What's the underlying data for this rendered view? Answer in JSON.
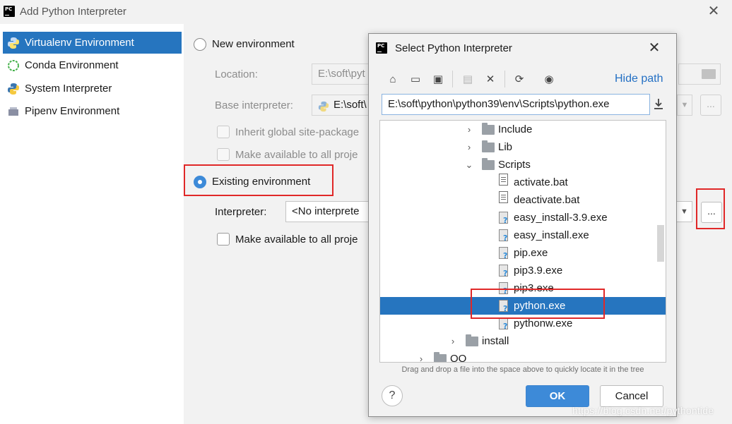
{
  "window": {
    "title": "Add Python Interpreter",
    "close_glyph": "✕"
  },
  "sidebar": {
    "items": [
      {
        "label": "Virtualenv Environment",
        "icon": "virtualenv-icon",
        "selected": true
      },
      {
        "label": "Conda Environment",
        "icon": "conda-icon",
        "selected": false
      },
      {
        "label": "System Interpreter",
        "icon": "python-icon",
        "selected": false
      },
      {
        "label": "Pipenv Environment",
        "icon": "pipenv-icon",
        "selected": false
      }
    ]
  },
  "new_env": {
    "radio_label": "New environment",
    "location_label": "Location:",
    "location_value": "E:\\soft\\pyt",
    "base_label": "Base interpreter:",
    "base_value": "E:\\soft\\",
    "inherit_label": "Inherit global site-package",
    "available_label": "Make available to all proje"
  },
  "existing_env": {
    "radio_label": "Existing environment",
    "interpreter_label": "Interpreter:",
    "interpreter_value": "<No interprete",
    "dots_label": "...",
    "available_label": "Make available to all proje"
  },
  "dialog": {
    "title": "Select Python Interpreter",
    "close_glyph": "✕",
    "toolbar": {
      "home": "⌂",
      "desktop": "▭",
      "project": "▣",
      "new_folder": "▤",
      "delete": "✕",
      "refresh": "⟳",
      "show_hidden": "◉"
    },
    "hide_path_label": "Hide path",
    "path_value": "E:\\soft\\python\\python39\\env\\Scripts\\python.exe",
    "tree": {
      "items": [
        {
          "label": "Include",
          "kind": "folder",
          "expander": "›"
        },
        {
          "label": "Lib",
          "kind": "folder",
          "expander": "›"
        },
        {
          "label": "Scripts",
          "kind": "folder",
          "expander": "⌄"
        },
        {
          "label": "activate.bat",
          "kind": "text"
        },
        {
          "label": "deactivate.bat",
          "kind": "text"
        },
        {
          "label": "easy_install-3.9.exe",
          "kind": "exe"
        },
        {
          "label": "easy_install.exe",
          "kind": "exe"
        },
        {
          "label": "pip.exe",
          "kind": "exe"
        },
        {
          "label": "pip3.9.exe",
          "kind": "exe"
        },
        {
          "label": "pip3.exe",
          "kind": "exe"
        },
        {
          "label": "python.exe",
          "kind": "exe",
          "selected": true
        },
        {
          "label": "pythonw.exe",
          "kind": "exe"
        },
        {
          "label": "install",
          "kind": "folder",
          "expander": "›"
        },
        {
          "label": "QQ",
          "kind": "folder",
          "expander": "›"
        }
      ]
    },
    "hint": "Drag and drop a file into the space above to quickly locate it in the tree",
    "help_label": "?",
    "ok_label": "OK",
    "cancel_label": "Cancel"
  },
  "watermark": "https://blog.csdn.net/pythontide",
  "colors": {
    "selection": "#2675bf",
    "accent_blue": "#3d8ad8",
    "highlight_red": "#e02828",
    "link_blue": "#2470c4"
  }
}
